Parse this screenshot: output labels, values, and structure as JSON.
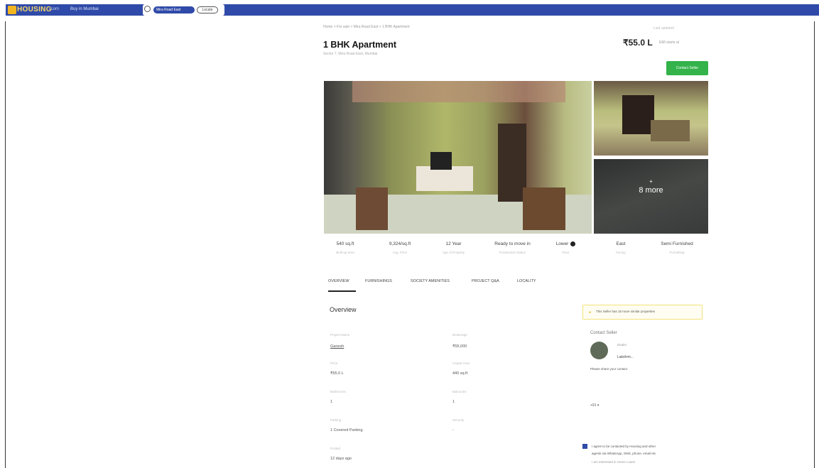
{
  "header": {
    "logo_text": "HOUSING",
    "logo_suffix": ".com",
    "city": "Buy in Mumbai",
    "search_chip": "Mira Road East",
    "location_button": "Locate"
  },
  "listing": {
    "breadcrumb": "Home > For sale > Mira Road East > 1 BHK Apartment",
    "top_right_link": "Last updated",
    "title": "1 BHK Apartment",
    "subtitle": "Sector 7, Mira Road East, Mumbai",
    "price": "₹55.0 L",
    "price_sub": "EMI starts at",
    "contact_button": "Contact Seller"
  },
  "gallery": {
    "more_label": "8 more",
    "plus": "+"
  },
  "specs": [
    {
      "value": "540 sq.ft",
      "label": "Built-up area"
    },
    {
      "value": "9,324/sq.ft",
      "label": "Avg. Price"
    },
    {
      "value": "12 Year",
      "label": "Age of Property"
    },
    {
      "value": "Ready to move in",
      "label": "Possession Status"
    },
    {
      "value": "Lower",
      "label": "Floor"
    },
    {
      "value": "East",
      "label": "Facing"
    },
    {
      "value": "Semi Furnished",
      "label": "Furnishing"
    }
  ],
  "tabs": [
    "OVERVIEW",
    "FURNISHINGS",
    "SOCIETY AMENITIES",
    "PROJECT Q&A",
    "LOCALITY"
  ],
  "overview": {
    "title": "Overview",
    "fields": [
      {
        "label": "Project Name",
        "value": "Ganesh"
      },
      {
        "label": "Brokerage",
        "value": "₹55,000"
      },
      {
        "label": "Price",
        "value": "₹55.0 L"
      },
      {
        "label": "Carpet Area",
        "value": "440 sq.ft"
      },
      {
        "label": "Bathrooms",
        "value": "1"
      },
      {
        "label": "Balconies",
        "value": "1"
      },
      {
        "label": "Parking",
        "value": "1 Covered Parking"
      },
      {
        "label": "Security",
        "value": "-"
      },
      {
        "label": "Posted",
        "value": "12 days ago"
      }
    ]
  },
  "sidebar": {
    "alert_text": "This Seller has 15 more similar properties",
    "contact_heading": "Contact Seller",
    "seller_type": "Dealer",
    "seller_name": "Lakshmi...",
    "share_prompt": "Please share your contact",
    "country_code": "+91 ▾",
    "consent_line1": "I agree to be contacted by Housing and other",
    "consent_line2": "agents via WhatsApp, SMS, phone, email etc",
    "consent_sub": "I am interested in Home Loans"
  },
  "colors": {
    "brand_blue": "#2f4aa8",
    "logo_yellow": "#f3b520",
    "cta_green": "#34b34a",
    "alert_border": "#f1e27a"
  }
}
